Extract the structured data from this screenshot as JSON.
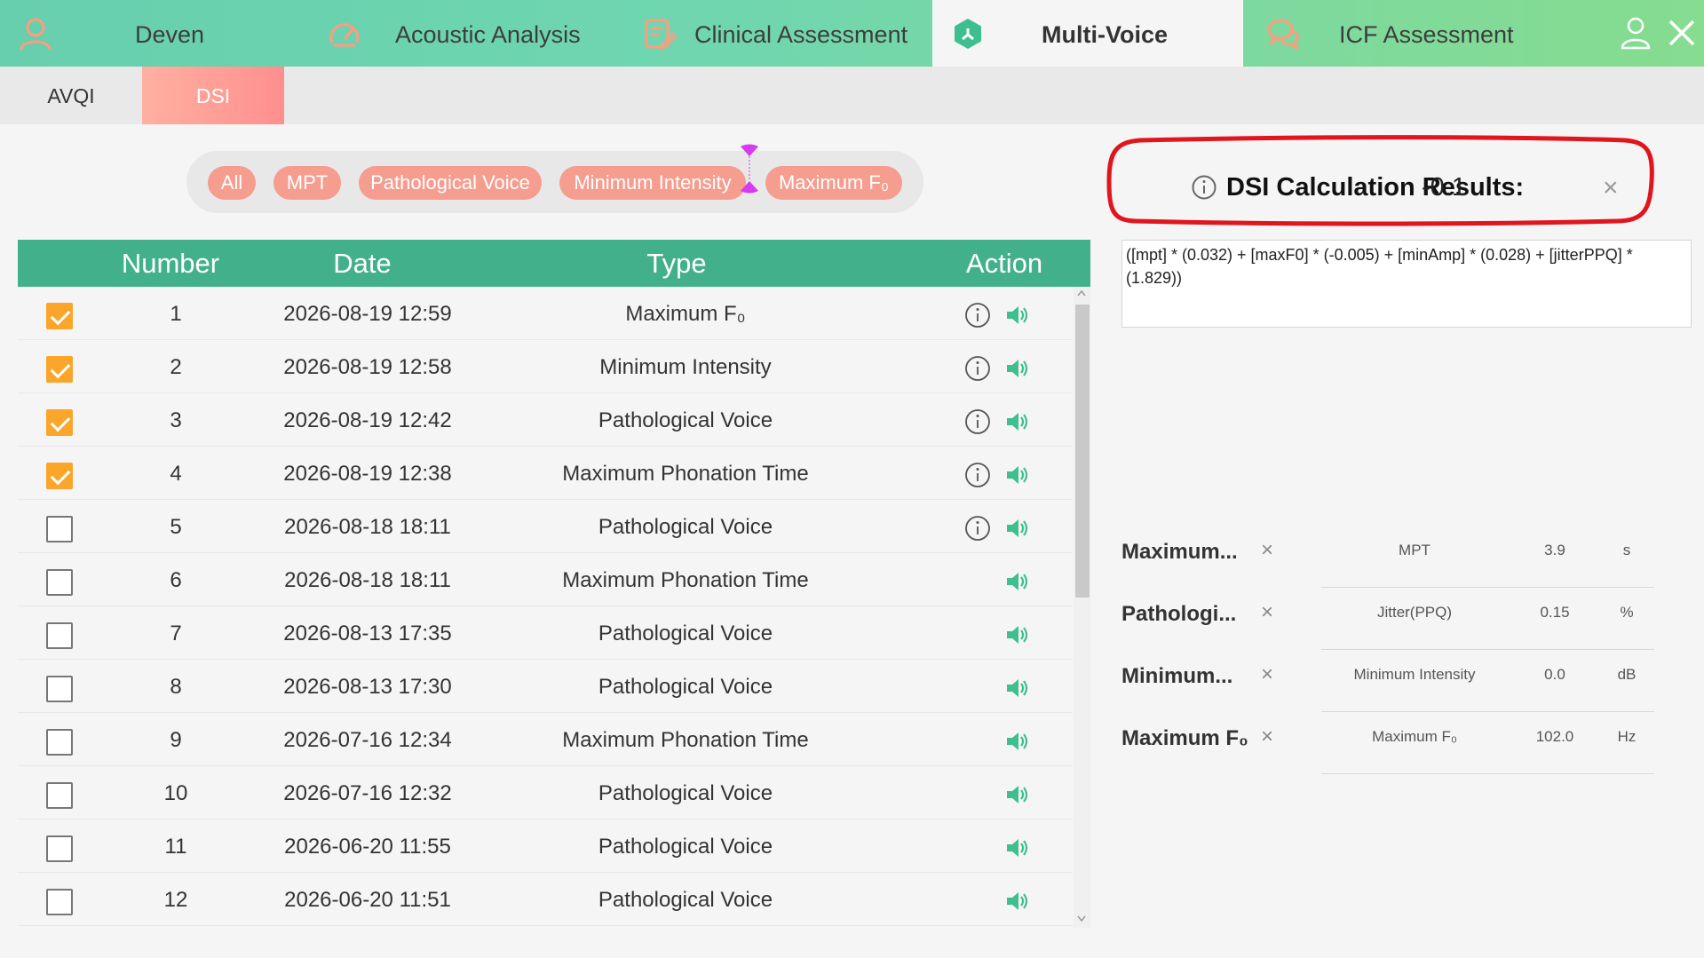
{
  "nav": {
    "tabs": [
      {
        "label": "Deven",
        "icon": "user-icon"
      },
      {
        "label": "Acoustic Analysis",
        "icon": "gauge-icon"
      },
      {
        "label": "Clinical Assessment",
        "icon": "clipboard-icon"
      },
      {
        "label": "Multi-Voice",
        "icon": "hexagon-icon",
        "active": true
      },
      {
        "label": "ICF Assessment",
        "icon": "chat-icon"
      }
    ]
  },
  "subtabs": [
    {
      "label": "AVQI"
    },
    {
      "label": "DSI",
      "active": true
    }
  ],
  "filters": [
    "All",
    "MPT",
    "Pathological Voice",
    "Minimum Intensity",
    "Maximum F₀"
  ],
  "table": {
    "headers": {
      "number": "Number",
      "date": "Date",
      "type": "Type",
      "action": "Action"
    },
    "rows": [
      {
        "number": "1",
        "date": "2026-08-19 12:59",
        "type": "Maximum F₀",
        "checked": true,
        "info": true
      },
      {
        "number": "2",
        "date": "2026-08-19 12:58",
        "type": "Minimum Intensity",
        "checked": true,
        "info": true
      },
      {
        "number": "3",
        "date": "2026-08-19 12:42",
        "type": "Pathological Voice",
        "checked": true,
        "info": true
      },
      {
        "number": "4",
        "date": "2026-08-19 12:38",
        "type": "Maximum Phonation Time",
        "checked": true,
        "info": true
      },
      {
        "number": "5",
        "date": "2026-08-18 18:11",
        "type": "Pathological Voice",
        "checked": false,
        "info": true
      },
      {
        "number": "6",
        "date": "2026-08-18 18:11",
        "type": "Maximum Phonation Time",
        "checked": false,
        "info": false
      },
      {
        "number": "7",
        "date": "2026-08-13 17:35",
        "type": "Pathological Voice",
        "checked": false,
        "info": false
      },
      {
        "number": "8",
        "date": "2026-08-13 17:30",
        "type": "Pathological Voice",
        "checked": false,
        "info": false
      },
      {
        "number": "9",
        "date": "2026-07-16 12:34",
        "type": "Maximum Phonation Time",
        "checked": false,
        "info": false
      },
      {
        "number": "10",
        "date": "2026-07-16 12:32",
        "type": "Pathological Voice",
        "checked": false,
        "info": false
      },
      {
        "number": "11",
        "date": "2026-06-20 11:55",
        "type": "Pathological Voice",
        "checked": false,
        "info": false
      },
      {
        "number": "12",
        "date": "2026-06-20 11:51",
        "type": "Pathological Voice",
        "checked": false,
        "info": false
      }
    ]
  },
  "result": {
    "label": "DSI Calculation Results:",
    "value": "-0.1",
    "close": "×",
    "formula": "([mpt] * (0.032) + [maxF0] * (-0.005) + [minAmp] * (0.028) + [jitterPPQ] * (1.829))"
  },
  "params": [
    {
      "name": "Maximum...",
      "measure": "MPT",
      "value": "3.9",
      "unit": "s"
    },
    {
      "name": "Pathologi...",
      "measure": "Jitter(PPQ)",
      "value": "0.15",
      "unit": "%"
    },
    {
      "name": "Minimum...",
      "measure": "Minimum Intensity",
      "value": "0.0",
      "unit": "dB"
    },
    {
      "name": "Maximum F₀",
      "measure": "Maximum F₀",
      "value": "102.0",
      "unit": "Hz"
    }
  ],
  "colors": {
    "nav_gradient_start": "#67cfae",
    "nav_gradient_end": "#86dc8f",
    "accent_coral": "#f59d8f",
    "table_header": "#43b08c",
    "checkbox_on": "#fba52a",
    "sound_icon": "#3fbf8f",
    "highlight_ring": "#e0151d"
  }
}
